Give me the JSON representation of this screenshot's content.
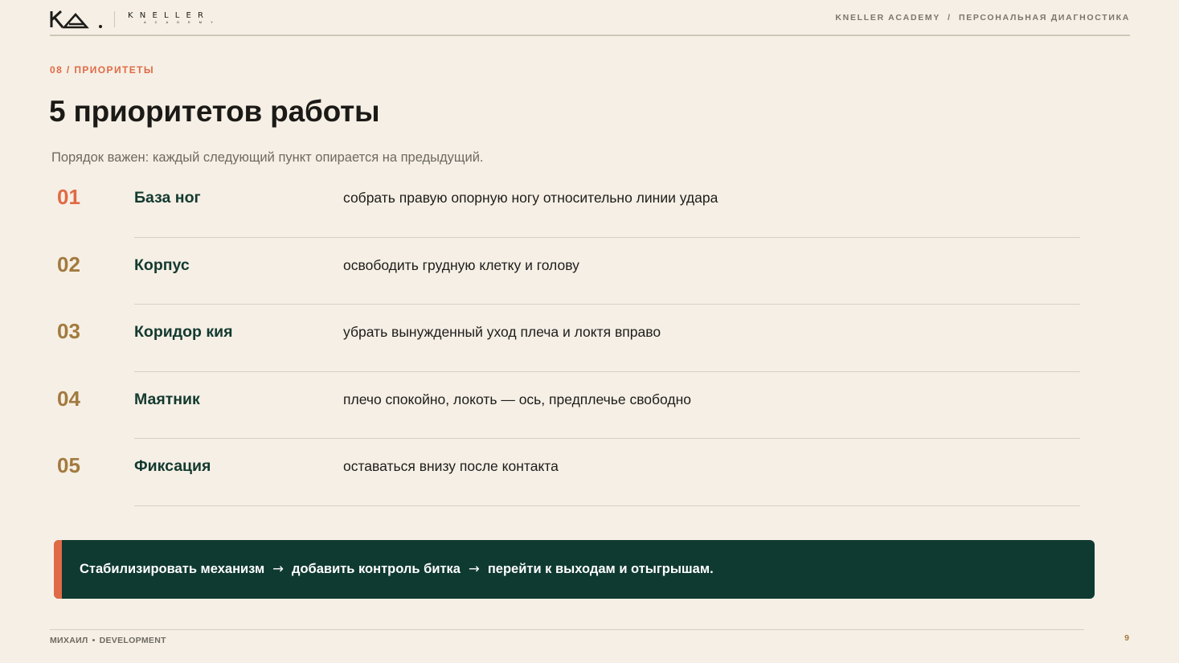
{
  "header": {
    "logo_mark": "KA.",
    "logo_word": "KNELLER",
    "logo_sub": "ACADEMY",
    "breadcrumb": "KNELLER ACADEMY  /  ПЕРСОНАЛЬНАЯ ДИАГНОСТИКА"
  },
  "section": {
    "label": "08 / ПРИОРИТЕТЫ",
    "title": "5 приоритетов работы",
    "subtitle": "Порядок важен: каждый следующий пункт опирается на предыдущий."
  },
  "priorities": [
    {
      "num": "01",
      "name": "База ног",
      "desc": "собрать правую опорную ногу относительно линии удара"
    },
    {
      "num": "02",
      "name": "Корпус",
      "desc": "освободить грудную клетку и голову"
    },
    {
      "num": "03",
      "name": "Коридор кия",
      "desc": "убрать вынужденный уход плеча и локтя вправо"
    },
    {
      "num": "04",
      "name": "Маятник",
      "desc": "плечо спокойно, локоть — ось, предплечье свободно"
    },
    {
      "num": "05",
      "name": "Фиксация",
      "desc": "оставаться внизу после контакта"
    }
  ],
  "callout": {
    "step1": "Стабилизировать механизм",
    "arrow": "→",
    "step2": "добавить контроль битка",
    "step3": "перейти к выходам и отыгрышам."
  },
  "footer": {
    "author": "МИХАИЛ",
    "separator": "•",
    "tag": "DEVELOPMENT",
    "page": "9"
  },
  "colors": {
    "background": "#f6efe5",
    "accent": "#e06a45",
    "number_gold": "#a27a3f",
    "dark_green": "#0f3a31"
  }
}
